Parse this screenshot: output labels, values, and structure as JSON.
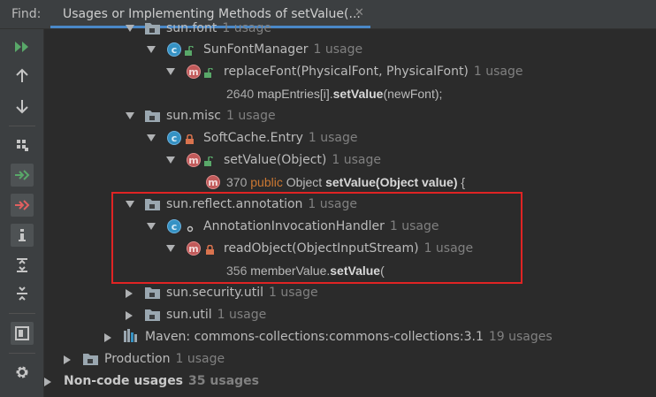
{
  "header": {
    "find_label": "Find:",
    "tab_title": "Usages or Implementing Methods of setValue(...",
    "close_glyph": "✕"
  },
  "toolbar": {
    "buttons": [
      "rerun-icon",
      "previous-occurrence-icon",
      "next-occurrence-icon",
      "group-by-icon",
      "merge-icon",
      "navigate-icon",
      "info-icon",
      "expand-all-icon",
      "collapse-all-icon",
      "preview-icon",
      "settings-icon"
    ]
  },
  "tree": {
    "sun_font": {
      "name": "sun.font",
      "count": "1 usage"
    },
    "sunfontmanager": {
      "name": "SunFontManager",
      "count": "1 usage"
    },
    "replacefont": {
      "name": "replaceFont(PhysicalFont, PhysicalFont)",
      "count": "1 usage"
    },
    "line1": {
      "num": "2640",
      "pre": "mapEntries[i].",
      "bold": "setValue",
      "post": "(newFont);"
    },
    "sun_misc": {
      "name": "sun.misc",
      "count": "1 usage"
    },
    "softcache": {
      "name": "SoftCache.Entry",
      "count": "1 usage"
    },
    "setvalue_obj": {
      "name": "setValue(Object)",
      "count": "1 usage"
    },
    "line2": {
      "num": "370",
      "kw": "public",
      "pre": "Object",
      "bold": "setValue(Object value)",
      "post": "{"
    },
    "sun_reflect": {
      "name": "sun.reflect.annotation",
      "count": "1 usage"
    },
    "aih": {
      "name": "AnnotationInvocationHandler",
      "count": "1 usage"
    },
    "readobject": {
      "name": "readObject(ObjectInputStream)",
      "count": "1 usage"
    },
    "line3": {
      "num": "356",
      "pre": "memberValue.",
      "bold": "setValue",
      "post": "("
    },
    "sun_security": {
      "name": "sun.security.util",
      "count": "1 usage"
    },
    "sun_util": {
      "name": "sun.util",
      "count": "1 usage"
    },
    "maven": {
      "name": "Maven: commons-collections:commons-collections:3.1",
      "count": "19 usages"
    },
    "production": {
      "name": "Production",
      "count": "1 usage"
    },
    "noncode": {
      "name": "Non-code usages",
      "count": "35 usages"
    }
  },
  "colors": {
    "accent": "#4a88c7",
    "highlight_border": "#e02424",
    "keyword": "#cc7832",
    "class_icon": "#3592c4",
    "method_icon": "#c15a5a"
  }
}
